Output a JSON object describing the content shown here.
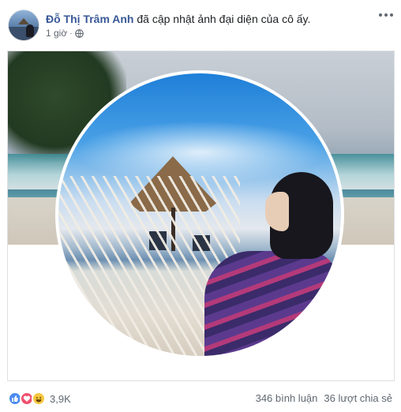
{
  "post": {
    "author": "Đỗ Thị Trâm Anh",
    "action": "đã cập nhật ảnh đại diện của cô ấy.",
    "time": "1 giờ",
    "separator": "·",
    "privacy_icon": "globe-icon",
    "more_icon": "more-options-icon"
  },
  "footer": {
    "reaction_icons": [
      "like-icon",
      "love-icon",
      "haha-icon"
    ],
    "reaction_count": "3,9K",
    "comments": "346 bình luận",
    "shares": "36 lượt chia sẻ"
  },
  "colors": {
    "author_link": "#385898",
    "meta_text": "#616770",
    "like": "#4a8bf0",
    "love": "#f0506e",
    "haha": "#f7c840"
  }
}
